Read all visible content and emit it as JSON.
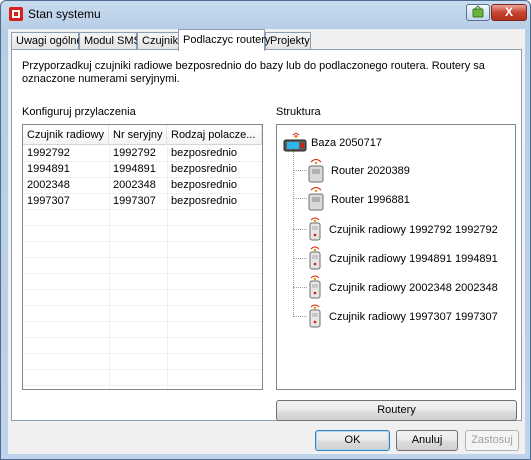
{
  "window": {
    "title": "Stan systemu",
    "close_label": "X"
  },
  "tabs": [
    {
      "label": "Uwagi ogólne"
    },
    {
      "label": "Modul SMS"
    },
    {
      "label": "Czujnik"
    },
    {
      "label": "Podlaczyc routery"
    },
    {
      "label": "Projekty"
    }
  ],
  "panel": {
    "description": "Przyporzadkuj czujniki radiowe bezposrednio do bazy lub do podlaczonego routera. Routery sa oznaczone numerami seryjnymi.",
    "config_label": "Konfiguruj przylaczenia",
    "structure_label": "Struktura",
    "columns": [
      "Czujnik radiowy",
      "Nr seryjny",
      "Rodzaj polacze..."
    ],
    "rows": [
      [
        "1992792",
        "1992792",
        "bezposrednio"
      ],
      [
        "1994891",
        "1994891",
        "bezposrednio"
      ],
      [
        "2002348",
        "2002348",
        "bezposrednio"
      ],
      [
        "1997307",
        "1997307",
        "bezposrednio"
      ]
    ],
    "tree": {
      "root": "Baza 2050717",
      "children": [
        "Router 2020389",
        "Router 1996881",
        "Czujnik radiowy 1992792 1992792",
        "Czujnik radiowy 1994891 1994891",
        "Czujnik radiowy 2002348 2002348",
        "Czujnik radiowy 1997307 1997307"
      ]
    },
    "routers_button": "Routery"
  },
  "footer": {
    "ok": "OK",
    "cancel": "Anuluj",
    "apply": "Zastosuj"
  },
  "colors": {
    "accent": "#3c7fb1",
    "close_red": "#c7432f",
    "signal_red": "#d81e05"
  }
}
